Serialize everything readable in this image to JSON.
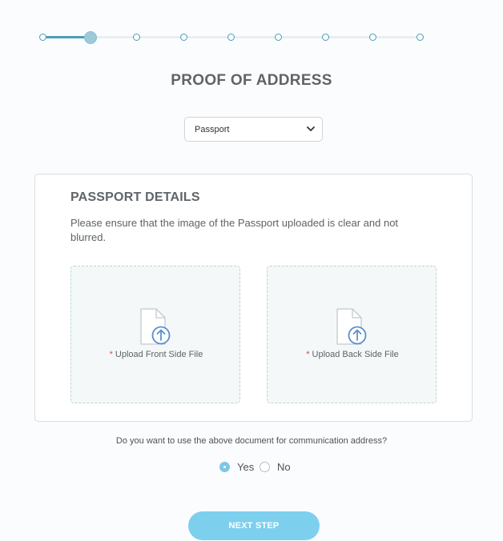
{
  "page_title": "PROOF OF ADDRESS",
  "stepper": {
    "total_steps": 9,
    "current_step": 2
  },
  "document_select": {
    "value": "Passport"
  },
  "card": {
    "title": "PASSPORT DETAILS",
    "description": "Please ensure that the image of the Passport uploaded is clear and not blurred.",
    "upload_front": {
      "required_mark": "*",
      "label": "Upload Front Side File"
    },
    "upload_back": {
      "required_mark": "*",
      "label": "Upload Back Side File"
    }
  },
  "communication": {
    "question": "Do you want to use the above document for communication address?",
    "options": [
      {
        "label": "Yes",
        "checked": true
      },
      {
        "label": "No",
        "checked": false
      }
    ]
  },
  "next_button": {
    "label": "NEXT STEP"
  },
  "colors": {
    "accent": "#4a9fb4",
    "button": "#7dcfee",
    "required": "#e04a3f"
  }
}
